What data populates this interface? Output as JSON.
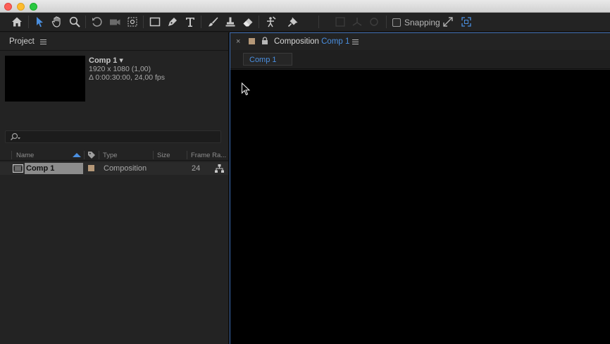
{
  "toolbar": {
    "tools": [
      "home-icon",
      "selection-tool-icon",
      "hand-tool-icon",
      "zoom-tool-icon",
      "rotation-tool-icon",
      "camera-tool-icon",
      "pan-behind-tool-icon",
      "rectangle-tool-icon",
      "pen-tool-icon",
      "type-tool-icon",
      "brush-tool-icon",
      "clone-stamp-tool-icon",
      "eraser-tool-icon",
      "roto-brush-tool-icon",
      "puppet-pin-tool-icon"
    ],
    "snapping_label": "Snapping",
    "snapping_checked": false
  },
  "project": {
    "title": "Project",
    "selected_item": {
      "name": "Comp 1 ▾",
      "resolution": "1920 x 1080 (1,00)",
      "duration": "Δ 0:00:30:00, 24,00 fps"
    },
    "search_placeholder": "",
    "columns": [
      "Name",
      "Type",
      "Size",
      "Frame Ra..."
    ],
    "items": [
      {
        "name": "Comp 1",
        "label_color": "#b59878",
        "type": "Composition",
        "size": "",
        "frame_rate": "24"
      }
    ]
  },
  "composition": {
    "panel_title": "Composition",
    "panel_subtitle": "Comp 1",
    "tab_label": "Comp 1",
    "label_color": "#b59878",
    "accent": "#4a8fe0"
  }
}
